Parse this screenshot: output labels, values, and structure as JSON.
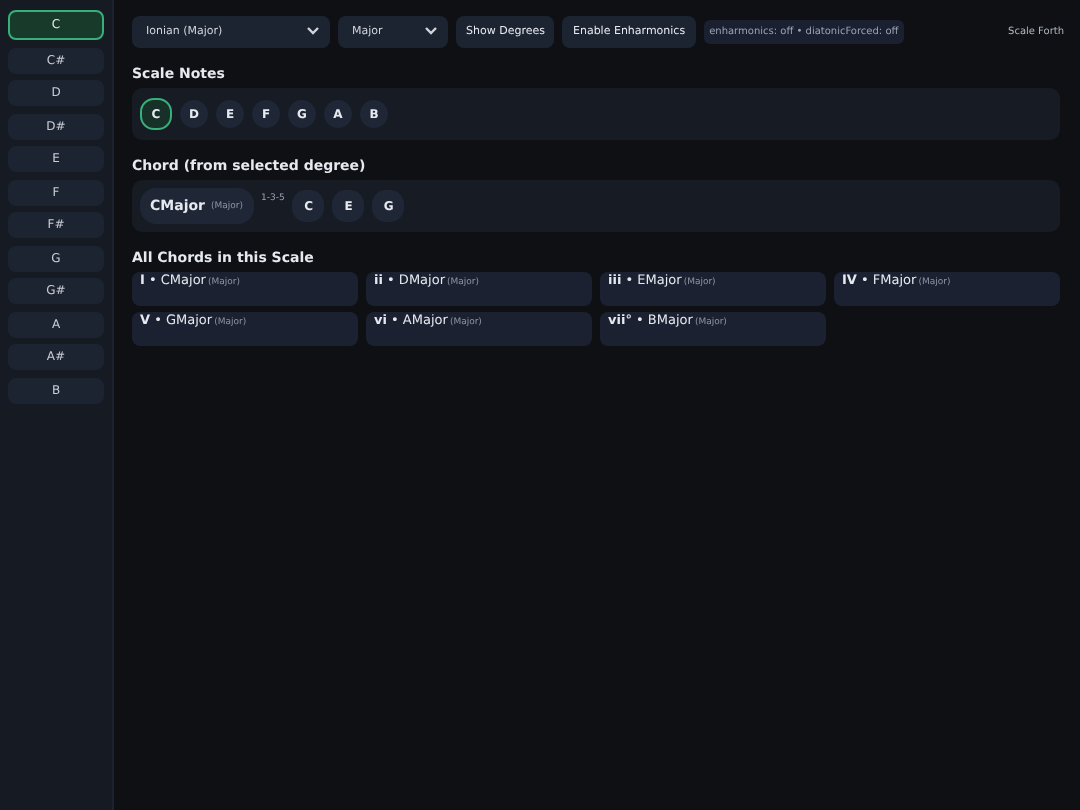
{
  "keys": [
    {
      "label": "C",
      "selected": true
    },
    {
      "label": "C#",
      "selected": false
    },
    {
      "label": "D",
      "selected": false
    },
    {
      "label": "D#",
      "selected": false
    },
    {
      "label": "E",
      "selected": false
    },
    {
      "label": "F",
      "selected": false
    },
    {
      "label": "F#",
      "selected": false
    },
    {
      "label": "G",
      "selected": false
    },
    {
      "label": "G#",
      "selected": false
    },
    {
      "label": "A",
      "selected": false
    },
    {
      "label": "A#",
      "selected": false
    },
    {
      "label": "B",
      "selected": false
    }
  ],
  "toolbar": {
    "mode_select": "Ionian (Major)",
    "quality_select": "Major",
    "buttons": [
      "Show Degrees",
      "Enable Enharmonics"
    ],
    "status": "enharmonics: off • diatonicForced: off",
    "app_name": "Scale Forth"
  },
  "scale_notes": {
    "title": "Scale Notes",
    "notes": [
      {
        "label": "C",
        "selected": true
      },
      {
        "label": "D",
        "selected": false
      },
      {
        "label": "E",
        "selected": false
      },
      {
        "label": "F",
        "selected": false
      },
      {
        "label": "G",
        "selected": false
      },
      {
        "label": "A",
        "selected": false
      },
      {
        "label": "B",
        "selected": false
      }
    ]
  },
  "chord": {
    "title": "Chord (from selected degree)",
    "name": "CMajor",
    "quality": "(Major)",
    "formula": "1-3-5",
    "notes": [
      "C",
      "E",
      "G"
    ]
  },
  "all_chords": {
    "title": "All Chords in this Scale",
    "chords": [
      {
        "degree": "I",
        "name": "• CMajor",
        "quality": "(Major)"
      },
      {
        "degree": "ii",
        "name": "• DMajor",
        "quality": "(Major)"
      },
      {
        "degree": "iii",
        "name": "• EMajor",
        "quality": "(Major)"
      },
      {
        "degree": "IV",
        "name": "• FMajor",
        "quality": "(Major)"
      },
      {
        "degree": "V",
        "name": "• GMajor",
        "quality": "(Major)"
      },
      {
        "degree": "vi",
        "name": "• AMajor",
        "quality": "(Major)"
      },
      {
        "degree": "vii°",
        "name": "• BMajor",
        "quality": "(Major)"
      }
    ]
  }
}
